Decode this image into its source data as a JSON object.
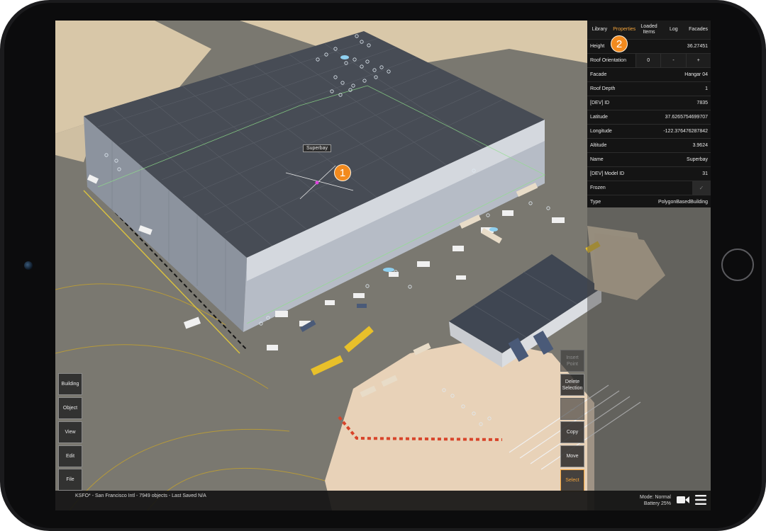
{
  "tabs": [
    {
      "label": "Library",
      "active": false
    },
    {
      "label": "Properties",
      "active": true
    },
    {
      "label": "Loaded Items",
      "active": false
    },
    {
      "label": "Log",
      "active": false
    },
    {
      "label": "Facades",
      "active": false
    }
  ],
  "properties": {
    "height": {
      "label": "Height",
      "value": "36.27451"
    },
    "roof_orientation": {
      "label": "Roof Orientation",
      "buttons": [
        "0",
        "-",
        "+"
      ]
    },
    "facade": {
      "label": "Facade",
      "value": "Hangar 04"
    },
    "roof_depth": {
      "label": "Roof Depth",
      "value": "1"
    },
    "dev_id": {
      "label": "[DEV] ID",
      "value": "7835"
    },
    "latitude": {
      "label": "Latitude",
      "value": "37.6265754699707"
    },
    "longitude": {
      "label": "Longitude",
      "value": "-122.376476287842"
    },
    "altitude": {
      "label": "Altitude",
      "value": "3.9624"
    },
    "name": {
      "label": "Name",
      "value": "Superbay"
    },
    "dev_model_id": {
      "label": "[DEV] Model ID",
      "value": "31"
    },
    "frozen": {
      "label": "Frozen",
      "toggle_glyph": "✓"
    },
    "type": {
      "label": "Type",
      "value": "PolygonBasedBuilding"
    }
  },
  "building_tag": "Superbay",
  "tools": {
    "building": "Building",
    "object": "Object",
    "view": "View",
    "edit": "Edit",
    "file": "File"
  },
  "actions": {
    "insert_point": "Insert Point",
    "delete_selection": "Delete Selection",
    "unknown": "...",
    "copy": "Copy",
    "move": "Move",
    "select": "Select"
  },
  "status": {
    "text": "KSFO* - San Francisco Intl - 7949 objects - Last Saved N/A",
    "mode": "Mode: Normal",
    "battery": "Battery 25%"
  },
  "badges": [
    "1",
    "2"
  ],
  "icons": {
    "camera": "video-camera-icon",
    "menu": "hamburger-menu-icon"
  },
  "colors": {
    "accent": "#f2a33a",
    "badge": "#f28a1e",
    "panel_bg": "#141414"
  }
}
